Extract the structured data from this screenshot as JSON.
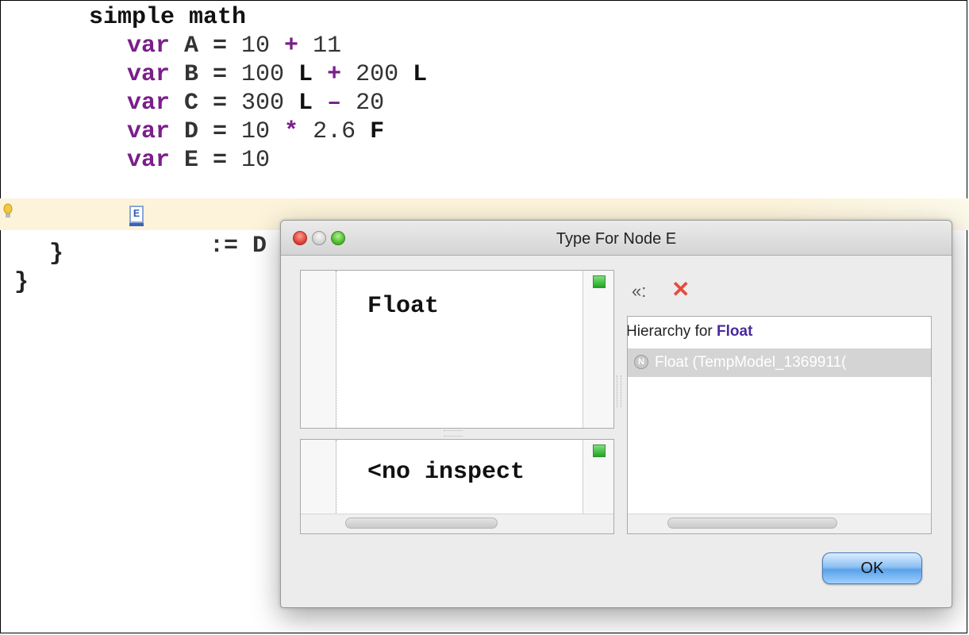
{
  "editor": {
    "lines": [
      {
        "tokens": [
          {
            "t": "simple math",
            "c": "bold"
          }
        ]
      },
      {
        "tokens": [
          {
            "t": "var",
            "c": "kw"
          },
          {
            "t": " A = ",
            "c": "plain"
          },
          {
            "t": "10",
            "c": "num"
          },
          {
            "t": " + ",
            "c": "op"
          },
          {
            "t": "11",
            "c": "num"
          }
        ]
      },
      {
        "tokens": [
          {
            "t": "var",
            "c": "kw"
          },
          {
            "t": " B = ",
            "c": "plain"
          },
          {
            "t": "100",
            "c": "num"
          },
          {
            "t": " L",
            "c": "bold"
          },
          {
            "t": " + ",
            "c": "op"
          },
          {
            "t": "200",
            "c": "num"
          },
          {
            "t": " L",
            "c": "bold"
          }
        ]
      },
      {
        "tokens": [
          {
            "t": "var",
            "c": "kw"
          },
          {
            "t": " C = ",
            "c": "plain"
          },
          {
            "t": "300",
            "c": "num"
          },
          {
            "t": " L",
            "c": "bold"
          },
          {
            "t": " – ",
            "c": "op"
          },
          {
            "t": "20",
            "c": "num"
          }
        ]
      },
      {
        "tokens": [
          {
            "t": "var",
            "c": "kw"
          },
          {
            "t": " D = ",
            "c": "plain"
          },
          {
            "t": "10",
            "c": "num"
          },
          {
            "t": " * ",
            "c": "op"
          },
          {
            "t": "2.6",
            "c": "num"
          },
          {
            "t": " F",
            "c": "bold"
          }
        ]
      },
      {
        "tokens": [
          {
            "t": "var",
            "c": "kw"
          },
          {
            "t": " E = ",
            "c": "plain"
          },
          {
            "t": "10",
            "c": "num"
          }
        ]
      }
    ],
    "assign_line": {
      "node_letter": "E",
      "rest": " := D"
    },
    "closing_brace_inner": "}",
    "closing_brace_outer": "}"
  },
  "dialog": {
    "title": "Type For Node E",
    "top_panel_text": "Float",
    "bottom_panel_text": "<no inspect",
    "hierarchy_prefix": "Hierarchy for ",
    "hierarchy_type": "Float",
    "hierarchy_item_icon": "N",
    "hierarchy_item": "Float (TempModel_1369911(",
    "collapse_glyph": "«:",
    "close_glyph": "✕",
    "ok_label": "OK"
  },
  "colors": {
    "keyword": "#7a1f8a",
    "highlight_line": "#fcf3da",
    "close_x": "#e54b3c",
    "ok_button": "#5aa2ea",
    "green_status": "#1fa51f"
  }
}
